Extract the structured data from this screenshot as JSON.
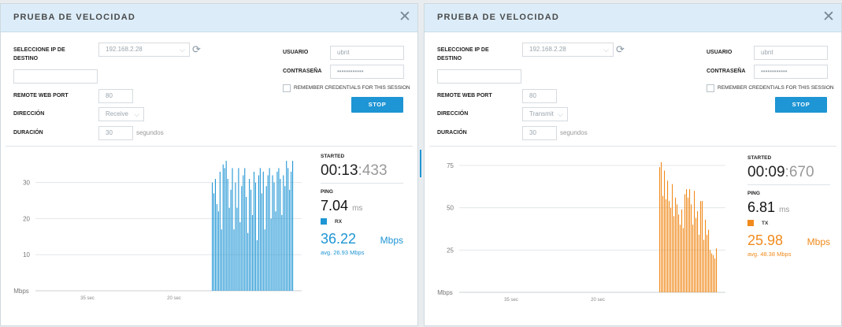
{
  "panels": [
    {
      "title": "PRUEBA DE VELOCIDAD",
      "labels": {
        "dest_ip": "SELECCIONE IP DE",
        "dest_ip2": "DESTINO",
        "remote_port": "REMOTE WEB PORT",
        "direction": "DIRECCIÓN",
        "duration": "DURACIÓN",
        "user": "USUARIO",
        "password": "CONTRASEÑA",
        "remember": "REMEMBER CREDENTIALS FOR THIS SESSION",
        "seconds": "segundos"
      },
      "fields": {
        "ip": "192.168.2.28",
        "port": "80",
        "direction": "Receive",
        "duration": "30",
        "user": "ubnt",
        "password": "••••••••••••"
      },
      "stop_button": "STOP",
      "stats": {
        "started_label": "STARTED",
        "started_main": "00:13",
        "started_ms": ":433",
        "ping_label": "PING",
        "ping_value": "7.04",
        "ping_unit": "ms",
        "series_label": "RX",
        "rate_value": "36.22",
        "rate_unit": "Mbps",
        "avg": "avg. 26.93 Mbps"
      },
      "accent": "#1e95d4",
      "chart_data": {
        "type": "bar",
        "series_name": "RX",
        "ylabel": "Mbps",
        "ylim": [
          0,
          38
        ],
        "yticks": [
          10,
          20,
          30
        ],
        "xticks": [
          "35 sec",
          "20 sec"
        ],
        "values": [
          30,
          27,
          31,
          24,
          22,
          33,
          17,
          35,
          34,
          36,
          31,
          23,
          28,
          34,
          17,
          30,
          23,
          34,
          19,
          29,
          32,
          34,
          26,
          16,
          31,
          28,
          21,
          33,
          30,
          14,
          32,
          34,
          27,
          33,
          17,
          29,
          32,
          34,
          20,
          32,
          30,
          22,
          33,
          34,
          31,
          21,
          32,
          29,
          36,
          34,
          28,
          33,
          36
        ]
      }
    },
    {
      "title": "PRUEBA DE VELOCIDAD",
      "labels": {
        "dest_ip": "SELECCIONE IP DE",
        "dest_ip2": "DESTINO",
        "remote_port": "REMOTE WEB PORT",
        "direction": "DIRECCIÓN",
        "duration": "DURACIÓN",
        "user": "USUARIO",
        "password": "CONTRASEÑA",
        "remember": "REMEMBER CREDENTIALS FOR THIS SESSION",
        "seconds": "segundos"
      },
      "fields": {
        "ip": "192.168.2.28",
        "port": "80",
        "direction": "Transmit",
        "duration": "30",
        "user": "ubnt",
        "password": "••••••••••••"
      },
      "stop_button": "STOP",
      "stats": {
        "started_label": "STARTED",
        "started_main": "00:09",
        "started_ms": ":670",
        "ping_label": "PING",
        "ping_value": "6.81",
        "ping_unit": "ms",
        "series_label": "TX",
        "rate_value": "25.98",
        "rate_unit": "Mbps",
        "avg": "avg. 48.38 Mbps"
      },
      "accent": "#f08a1c",
      "chart_data": {
        "type": "bar",
        "series_name": "TX",
        "ylabel": "Mbps",
        "ylim": [
          0,
          82
        ],
        "yticks": [
          25,
          50,
          75
        ],
        "xticks": [
          "35 sec",
          "20 sec"
        ],
        "values": [
          74,
          77,
          57,
          72,
          55,
          66,
          54,
          50,
          64,
          45,
          56,
          52,
          46,
          40,
          49,
          38,
          58,
          61,
          56,
          61,
          52,
          40,
          60,
          44,
          48,
          34,
          54,
          54,
          31,
          43,
          34,
          37,
          25,
          23,
          22,
          20,
          26
        ]
      }
    }
  ]
}
